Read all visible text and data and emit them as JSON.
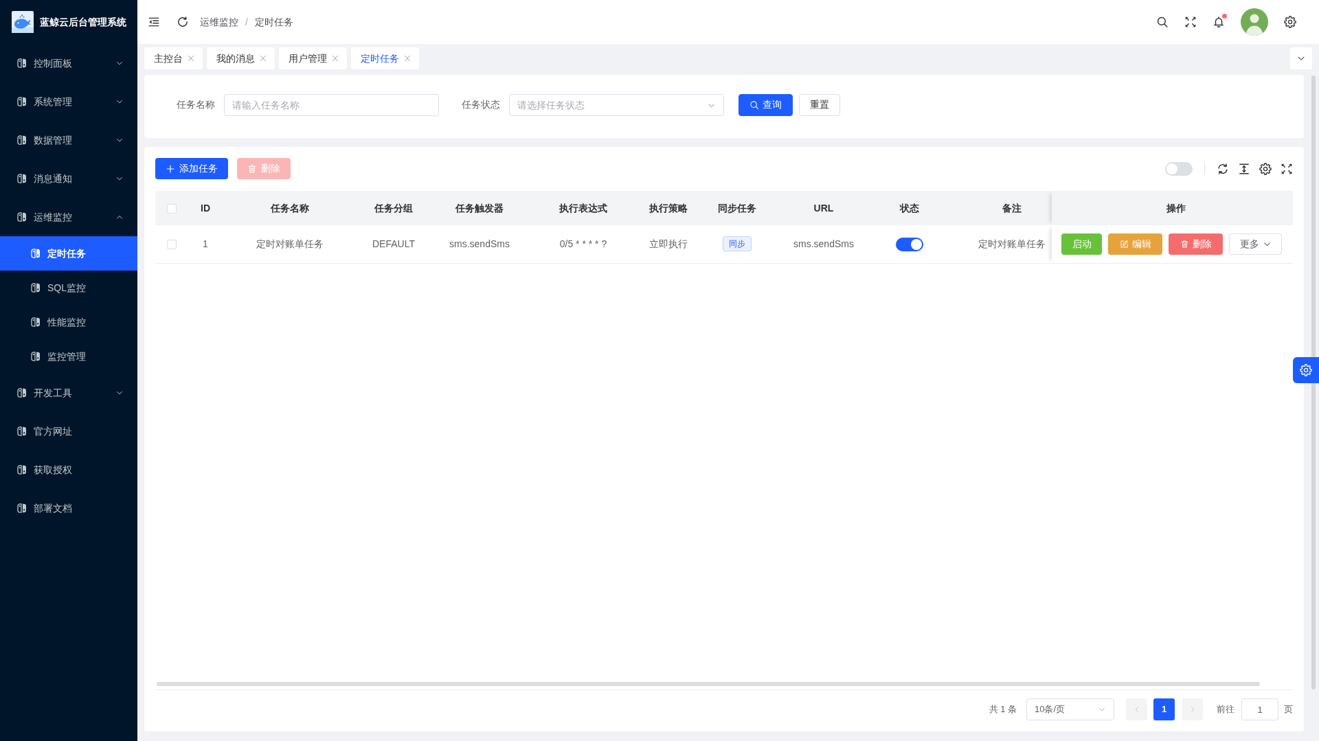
{
  "sidebar": {
    "title": "蓝鲸云后台管理系统",
    "items": [
      {
        "label": "控制面板",
        "expanded": false,
        "selected": false
      },
      {
        "label": "系统管理",
        "expanded": false,
        "selected": false
      },
      {
        "label": "数据管理",
        "expanded": false,
        "selected": false
      },
      {
        "label": "消息通知",
        "expanded": false,
        "selected": false
      },
      {
        "label": "运维监控",
        "expanded": true,
        "selected": false,
        "children": [
          {
            "label": "定时任务",
            "selected": true
          },
          {
            "label": "SQL监控",
            "selected": false
          },
          {
            "label": "性能监控",
            "selected": false
          },
          {
            "label": "监控管理",
            "selected": false
          }
        ]
      },
      {
        "label": "开发工具",
        "expanded": false,
        "selected": false
      },
      {
        "label": "官方网址",
        "selected": false
      },
      {
        "label": "获取授权",
        "selected": false
      },
      {
        "label": "部署文档",
        "selected": false
      }
    ]
  },
  "header": {
    "breadcrumb": {
      "items": [
        "运维监控",
        "定时任务"
      ],
      "separator": "/"
    },
    "unread_notifications": true
  },
  "tabs": [
    {
      "label": "主控台",
      "selected": false
    },
    {
      "label": "我的消息",
      "selected": false
    },
    {
      "label": "用户管理",
      "selected": false
    },
    {
      "label": "定时任务",
      "selected": true
    }
  ],
  "search_form": {
    "fields": [
      {
        "label": "任务名称",
        "kind": "input",
        "placeholder": "请输入任务名称"
      },
      {
        "label": "任务状态",
        "kind": "select",
        "placeholder": "请选择任务状态"
      }
    ],
    "buttons": [
      {
        "label": "查询",
        "kind": "primary"
      },
      {
        "label": "重置",
        "kind": "default"
      }
    ]
  },
  "toolbar": {
    "buttons": [
      {
        "label": "添加任务",
        "kind": "add",
        "disabled": false
      },
      {
        "label": "删除",
        "kind": "delete",
        "disabled": true
      }
    ],
    "toggle": {
      "on": false
    }
  },
  "table": {
    "header_checkbox": {
      "checked": false
    },
    "columns": [
      "ID",
      "任务名称",
      "任务分组",
      "任务触发器",
      "执行表达式",
      "执行策略",
      "同步任务",
      "URL",
      "状态",
      "备注",
      "操作"
    ],
    "rows": [
      {
        "checked": false,
        "cells": [
          {
            "kind": "text",
            "text": "1"
          },
          {
            "kind": "text",
            "text": "定时对账单任务"
          },
          {
            "kind": "text",
            "text": "DEFAULT"
          },
          {
            "kind": "text",
            "text": "sms.sendSms"
          },
          {
            "kind": "text",
            "text": "0/5 * * * * ?"
          },
          {
            "kind": "text",
            "text": "立即执行"
          },
          {
            "kind": "tag",
            "text": "同步"
          },
          {
            "kind": "text",
            "text": "sms.sendSms"
          },
          {
            "kind": "switch",
            "on": true
          },
          {
            "kind": "text",
            "text": "定时对账单任务"
          },
          {
            "kind": "actions",
            "buttons": [
              {
                "label": "启动",
                "kind": "start"
              },
              {
                "label": "编辑",
                "kind": "edit"
              },
              {
                "label": "删除",
                "kind": "delete"
              },
              {
                "label": "更多",
                "kind": "more"
              }
            ]
          }
        ]
      }
    ]
  },
  "pagination": {
    "total": "共 1 条",
    "page_size": "10条/页",
    "prev_disabled": true,
    "pages": [
      {
        "label": "1",
        "selected": true
      }
    ],
    "next_disabled": true,
    "goto_label": "前往",
    "goto_value": "1",
    "page_unit": "页"
  }
}
